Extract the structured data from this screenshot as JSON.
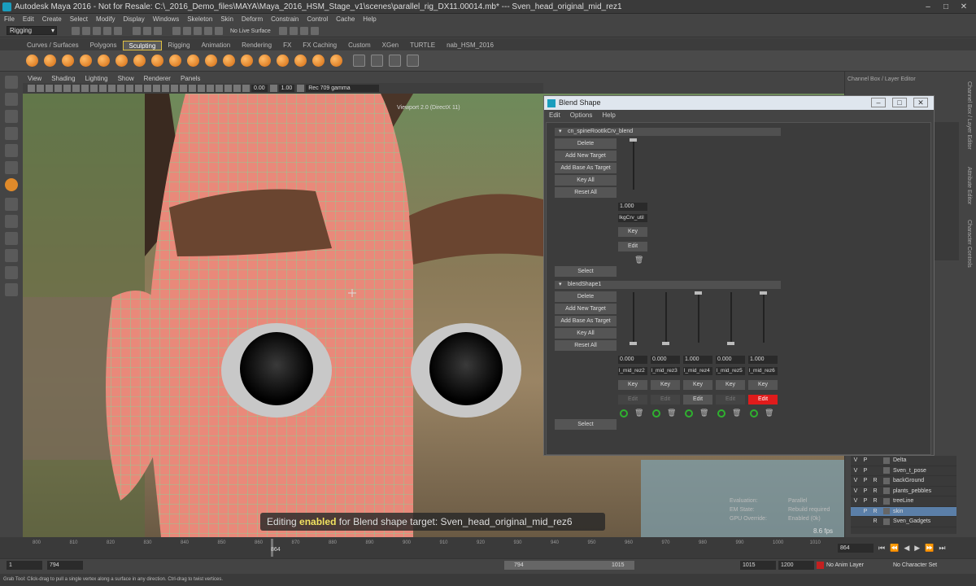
{
  "window": {
    "title": "Autodesk Maya 2016 - Not for Resale: C:\\_2016_Demo_files\\MAYA\\Maya_2016_HSM_Stage_v1\\scenes\\parallel_rig_DX11.00014.mb*   ---   Sven_head_original_mid_rez1"
  },
  "menubar": [
    "File",
    "Edit",
    "Create",
    "Select",
    "Modify",
    "Display",
    "Windows",
    "Skeleton",
    "Skin",
    "Deform",
    "Constrain",
    "Control",
    "Cache",
    "Help"
  ],
  "statusline": {
    "mode": "Rigging",
    "live_surface": "No Live Surface"
  },
  "shelf_tabs": [
    "Curves / Surfaces",
    "Polygons",
    "Sculpting",
    "Rigging",
    "Animation",
    "Rendering",
    "FX",
    "FX Caching",
    "Custom",
    "XGen",
    "TURTLE",
    "nab_HSM_2016"
  ],
  "shelf_active": "Sculpting",
  "viewport": {
    "menus": [
      "View",
      "Shading",
      "Lighting",
      "Show",
      "Renderer",
      "Panels"
    ],
    "field_a": "0.00",
    "field_b": "1.00",
    "color_space": "Rec 709 gamma",
    "label": "Viewport 2.0 (DirectX 11)",
    "hud": {
      "evaluation_label": "Evaluation:",
      "evaluation_value": "Parallel",
      "em_state_label": "EM State:",
      "em_state_value": "Rebuild required",
      "gpu_override_label": "GPU Override:",
      "gpu_override_value": "Enabled (0k)"
    },
    "fps": "8.6 fps"
  },
  "banner": {
    "prefix": "Editing",
    "highlight": "enabled",
    "suffix": "for Blend shape target: Sven_head_original_mid_rez6"
  },
  "channel_box": {
    "header": "Channel Box / Layer Editor",
    "side_tabs": [
      "Channel Box / Layer Editor",
      "Attribute Editor",
      "Character Controls"
    ],
    "layers": [
      {
        "v": "V",
        "p": "P",
        "r": "",
        "name": "Delta",
        "selected": false
      },
      {
        "v": "V",
        "p": "P",
        "r": "",
        "name": "Sven_t_pose",
        "selected": false
      },
      {
        "v": "V",
        "p": "P",
        "r": "R",
        "name": "backGround",
        "selected": false
      },
      {
        "v": "V",
        "p": "P",
        "r": "R",
        "name": "plants_pebbles",
        "selected": false
      },
      {
        "v": "V",
        "p": "P",
        "r": "R",
        "name": "treeLine",
        "selected": false
      },
      {
        "v": "",
        "p": "P",
        "r": "R",
        "name": "skin",
        "selected": true
      },
      {
        "v": "",
        "p": "",
        "r": "R",
        "name": "Sven_Gadgets",
        "selected": false
      }
    ]
  },
  "blend_shape": {
    "title": "Blend Shape",
    "menu": [
      "Edit",
      "Options",
      "Help"
    ],
    "node1": {
      "name": "cn_spineRootIkCrv_blend",
      "buttons": [
        "Delete",
        "Add New Target",
        "Add Base As Target",
        "Key All",
        "Reset All"
      ],
      "select": "Select",
      "targets": [
        {
          "value": "1.000",
          "weight": 1.0,
          "name": "IkgCrv_util",
          "key": "Key",
          "edit": "Edit",
          "edit_state": "normal"
        }
      ]
    },
    "node2": {
      "name": "blendShape1",
      "buttons": [
        "Delete",
        "Add New Target",
        "Add Base As Target",
        "Key All",
        "Reset All"
      ],
      "select": "Select",
      "targets": [
        {
          "value": "0.000",
          "weight": 0.0,
          "name": "l_mid_rez2",
          "key": "Key",
          "edit": "Edit",
          "edit_state": "disabled"
        },
        {
          "value": "0.000",
          "weight": 0.0,
          "name": "l_mid_rez3",
          "key": "Key",
          "edit": "Edit",
          "edit_state": "disabled"
        },
        {
          "value": "1.000",
          "weight": 1.0,
          "name": "l_mid_rez4",
          "key": "Key",
          "edit": "Edit",
          "edit_state": "normal"
        },
        {
          "value": "0.000",
          "weight": 0.0,
          "name": "l_mid_rez5",
          "key": "Key",
          "edit": "Edit",
          "edit_state": "disabled"
        },
        {
          "value": "1.000",
          "weight": 1.0,
          "name": "l_mid_rez6",
          "key": "Key",
          "edit": "Edit",
          "edit_state": "active"
        }
      ]
    }
  },
  "timeline": {
    "ticks": [
      "800",
      "810",
      "820",
      "830",
      "840",
      "850",
      "860",
      "870",
      "880",
      "890",
      "900",
      "910",
      "920",
      "930",
      "940",
      "950",
      "960",
      "970",
      "980",
      "990",
      "1000",
      "1010"
    ],
    "current_frame": "864",
    "current_frame_field": "864"
  },
  "range": {
    "start": "1",
    "start_inner": "794",
    "range_start": "794",
    "range_end": "1015",
    "end_inner": "1015",
    "end": "1200",
    "anim_layer": "No Anim Layer",
    "character_set": "No Character Set"
  },
  "help_line": "Grab Tool: Click-drag to pull a single vertex along a surface in any direction. Ctrl-drag to twist vertices."
}
